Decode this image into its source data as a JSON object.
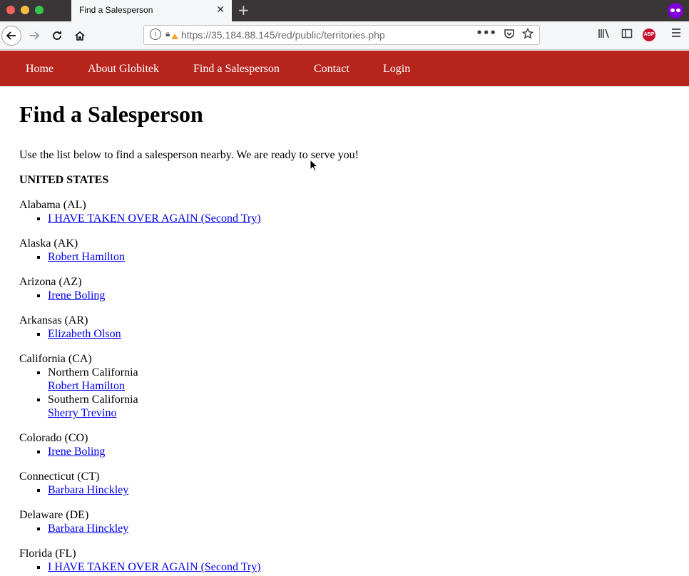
{
  "browser": {
    "tab_title": "Find a Salesperson",
    "tab_close": "✕",
    "new_tab": "+",
    "url_host": "https://35.184.88.145",
    "url_path": "/red/public/territories.php",
    "url_more": "•••",
    "icons": {
      "back": "arrow-left-icon",
      "forward": "arrow-right-icon",
      "reload": "reload-icon",
      "home": "home-icon",
      "info": "info-icon",
      "lock": "lock-warning-icon",
      "pocket": "pocket-icon",
      "star": "star-icon",
      "library": "library-icon",
      "sidebar": "sidebar-icon",
      "adblock": "adblock-icon",
      "menu": "hamburger-menu-icon",
      "private": "private-browsing-icon"
    },
    "abp_label": "ABP"
  },
  "site_nav": {
    "items": [
      {
        "label": "Home"
      },
      {
        "label": "About Globitek"
      },
      {
        "label": "Find a Salesperson"
      },
      {
        "label": "Contact"
      },
      {
        "label": "Login"
      }
    ],
    "color": "#b6241c"
  },
  "page": {
    "title": "Find a Salesperson",
    "intro": "Use the list below to find a salesperson nearby. We are ready to serve you!",
    "country": "UNITED STATES",
    "states": [
      {
        "name": "Alabama (AL)",
        "people": [
          "I HAVE TAKEN OVER AGAIN (Second Try)"
        ]
      },
      {
        "name": "Alaska (AK)",
        "people": [
          "Robert Hamilton"
        ]
      },
      {
        "name": "Arizona (AZ)",
        "people": [
          "Irene Boling"
        ]
      },
      {
        "name": "Arkansas (AR)",
        "people": [
          "Elizabeth Olson"
        ]
      },
      {
        "name": "California (CA)",
        "regions": [
          {
            "name": "Northern California",
            "person": "Robert Hamilton"
          },
          {
            "name": "Southern California",
            "person": "Sherry Trevino"
          }
        ]
      },
      {
        "name": "Colorado (CO)",
        "people": [
          "Irene Boling"
        ]
      },
      {
        "name": "Connecticut (CT)",
        "people": [
          "Barbara Hinckley"
        ]
      },
      {
        "name": "Delaware (DE)",
        "people": [
          "Barbara Hinckley"
        ]
      },
      {
        "name": "Florida (FL)",
        "people": [
          "I HAVE TAKEN OVER AGAIN (Second Try)"
        ]
      }
    ],
    "link_color": "#0000ee"
  }
}
